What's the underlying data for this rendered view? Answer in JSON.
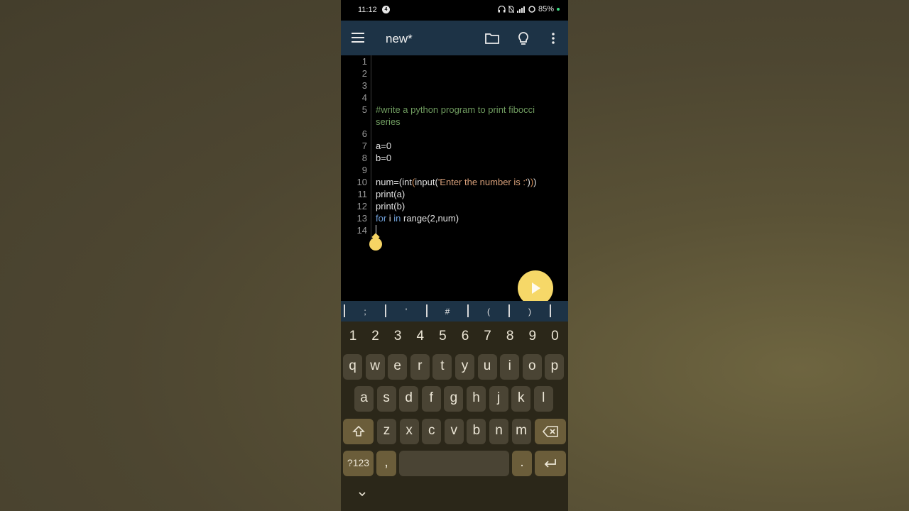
{
  "status_bar": {
    "time": "11:12",
    "notification_badge": "4",
    "battery": "85%"
  },
  "app_bar": {
    "title": "new*"
  },
  "editor": {
    "lines": [
      {
        "n": "1",
        "tokens": []
      },
      {
        "n": "2",
        "tokens": []
      },
      {
        "n": "3",
        "tokens": []
      },
      {
        "n": "4",
        "tokens": []
      },
      {
        "n": "5",
        "tokens": [
          {
            "t": "cmt",
            "v": "#write a python program to print fibocci"
          }
        ],
        "wrap": [
          {
            "t": "cmt",
            "v": "series"
          }
        ]
      },
      {
        "n": "6",
        "tokens": []
      },
      {
        "n": "7",
        "tokens": [
          {
            "t": "txt",
            "v": "a=0"
          }
        ]
      },
      {
        "n": "8",
        "tokens": [
          {
            "t": "txt",
            "v": "b=0"
          }
        ]
      },
      {
        "n": "9",
        "tokens": []
      },
      {
        "n": "10",
        "tokens": [
          {
            "t": "txt",
            "v": "num=(int"
          },
          {
            "t": "par",
            "v": "("
          },
          {
            "t": "txt",
            "v": "input("
          },
          {
            "t": "str",
            "v": "'Enter the number is :'"
          },
          {
            "t": "txt",
            "v": ")"
          },
          {
            "t": "par",
            "v": ")"
          },
          {
            "t": "txt",
            "v": ")"
          }
        ]
      },
      {
        "n": "11",
        "tokens": [
          {
            "t": "txt",
            "v": "print(a)"
          }
        ]
      },
      {
        "n": "12",
        "tokens": [
          {
            "t": "txt",
            "v": "print(b)"
          }
        ]
      },
      {
        "n": "13",
        "tokens": [
          {
            "t": "kw",
            "v": "for"
          },
          {
            "t": "txt",
            "v": " i "
          },
          {
            "t": "kw",
            "v": "in"
          },
          {
            "t": "txt",
            "v": " range(2,num)"
          }
        ]
      },
      {
        "n": "14",
        "tokens": []
      }
    ]
  },
  "symbol_bar": {
    "symbols": [
      ";",
      "'",
      "#",
      "(",
      ")"
    ]
  },
  "keyboard": {
    "numbers": [
      "1",
      "2",
      "3",
      "4",
      "5",
      "6",
      "7",
      "8",
      "9",
      "0"
    ],
    "row1": [
      "q",
      "w",
      "e",
      "r",
      "t",
      "y",
      "u",
      "i",
      "o",
      "p"
    ],
    "row2": [
      "a",
      "s",
      "d",
      "f",
      "g",
      "h",
      "j",
      "k",
      "l"
    ],
    "row3": [
      "z",
      "x",
      "c",
      "v",
      "b",
      "n",
      "m"
    ],
    "symbols_key": "?123",
    "comma": ",",
    "period": "."
  },
  "colors": {
    "app_bar": "#1d3346",
    "accent": "#f6d868",
    "keyboard_bg": "#2b2719"
  }
}
